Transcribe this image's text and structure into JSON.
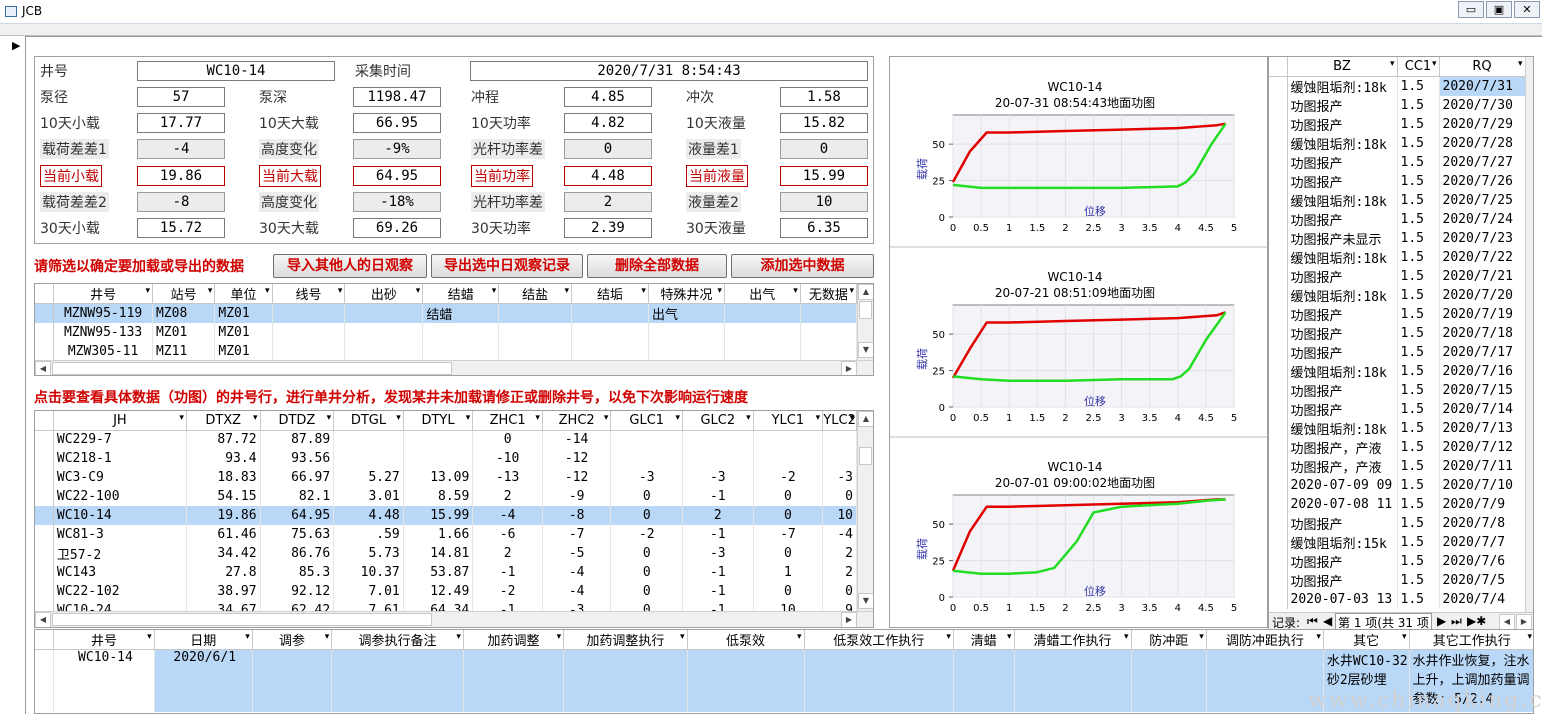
{
  "window": {
    "title": "JCB",
    "minimize": "▭",
    "restore": "▣",
    "close": "✕"
  },
  "info": {
    "r1": {
      "jh_label": "井号",
      "jh_val": "WC10-14",
      "cjsj_label": "采集时间",
      "cjsj_val": "2020/7/31  8:54:43"
    },
    "rows": [
      [
        {
          "l": "泵径",
          "v": "57",
          "t": "n"
        },
        {
          "l": "泵深",
          "v": "1198.47",
          "t": "n"
        },
        {
          "l": "冲程",
          "v": "4.85",
          "t": "n"
        },
        {
          "l": "冲次",
          "v": "1.58",
          "t": "n"
        }
      ],
      [
        {
          "l": "10天小载",
          "v": "17.77",
          "t": "n"
        },
        {
          "l": "10天大载",
          "v": "66.95",
          "t": "n"
        },
        {
          "l": "10天功率",
          "v": "4.82",
          "t": "n"
        },
        {
          "l": "10天液量",
          "v": "15.82",
          "t": "n"
        }
      ],
      [
        {
          "l": "载荷差差1",
          "v": "-4",
          "t": "g"
        },
        {
          "l": "高度变化",
          "v": "-9%",
          "t": "g"
        },
        {
          "l": "光杆功率差",
          "v": "0",
          "t": "g"
        },
        {
          "l": "液量差1",
          "v": "0",
          "t": "g"
        }
      ],
      [
        {
          "l": "当前小载",
          "v": "19.86",
          "t": "r"
        },
        {
          "l": "当前大载",
          "v": "64.95",
          "t": "r"
        },
        {
          "l": "当前功率",
          "v": "4.48",
          "t": "r"
        },
        {
          "l": "当前液量",
          "v": "15.99",
          "t": "r"
        }
      ],
      [
        {
          "l": "载荷差差2",
          "v": "-8",
          "t": "g"
        },
        {
          "l": "高度变化",
          "v": "-18%",
          "t": "g"
        },
        {
          "l": "光杆功率差",
          "v": "2",
          "t": "g"
        },
        {
          "l": "液量差2",
          "v": "10",
          "t": "g"
        }
      ],
      [
        {
          "l": "30天小载",
          "v": "15.72",
          "t": "n"
        },
        {
          "l": "30天大载",
          "v": "69.26",
          "t": "n"
        },
        {
          "l": "30天功率",
          "v": "2.39",
          "t": "n"
        },
        {
          "l": "30天液量",
          "v": "6.35",
          "t": "n"
        }
      ]
    ]
  },
  "filter_note": "请筛选以确定要加载或导出的数据",
  "buttons": {
    "import": "导入其他人的日观察",
    "export": "导出选中日观察记录",
    "delete_all": "删除全部数据",
    "add_selected": "添加选中数据"
  },
  "grid1": {
    "headers": [
      "井号",
      "站号",
      "单位",
      "线号",
      "出砂",
      "结蜡",
      "结盐",
      "结垢",
      "特殊井况",
      "出气",
      "无数据"
    ],
    "rows": [
      [
        "MZNW95-119",
        "MZ08",
        "MZ01",
        "",
        "",
        "结蜡",
        "",
        "",
        "出气",
        "",
        ""
      ],
      [
        "MZNW95-133",
        "MZ01",
        "MZ01",
        "",
        "",
        "",
        "",
        "",
        "",
        "",
        ""
      ],
      [
        "MZW305-11",
        "MZ11",
        "MZ01",
        "",
        "",
        "",
        "",
        "",
        "",
        "",
        ""
      ]
    ]
  },
  "click_note": "点击要查看具体数据（功图）的井号行，进行单井分析，发现某井未加载请修正或删除井号，以免下次影响运行速度",
  "grid2": {
    "headers": [
      "JH",
      "DTXZ",
      "DTDZ",
      "DTGL",
      "DTYL",
      "ZHC1",
      "ZHC2",
      "GLC1",
      "GLC2",
      "YLC1",
      "YLC2"
    ],
    "rows": [
      [
        "WC229-7",
        "87.72",
        "87.89",
        "",
        "",
        "0",
        "-14",
        "",
        "",
        "",
        ""
      ],
      [
        "WC218-1",
        "93.4",
        "93.56",
        "",
        "",
        "-10",
        "-12",
        "",
        "",
        "",
        ""
      ],
      [
        "WC3-C9",
        "18.83",
        "66.97",
        "5.27",
        "13.09",
        "-13",
        "-12",
        "-3",
        "-3",
        "-2",
        "-3"
      ],
      [
        "WC22-100",
        "54.15",
        "82.1",
        "3.01",
        "8.59",
        "2",
        "-9",
        "0",
        "-1",
        "0",
        "0"
      ],
      [
        "WC10-14",
        "19.86",
        "64.95",
        "4.48",
        "15.99",
        "-4",
        "-8",
        "0",
        "2",
        "0",
        "10"
      ],
      [
        "WC81-3",
        "61.46",
        "75.63",
        ".59",
        "1.66",
        "-6",
        "-7",
        "-2",
        "-1",
        "-7",
        "-4"
      ],
      [
        "卫57-2",
        "34.42",
        "86.76",
        "5.73",
        "14.81",
        "2",
        "-5",
        "0",
        "-3",
        "0",
        "2"
      ],
      [
        "WC143",
        "27.8",
        "85.3",
        "10.37",
        "53.87",
        "-1",
        "-4",
        "0",
        "-1",
        "1",
        "2"
      ],
      [
        "WC22-102",
        "38.97",
        "92.12",
        "7.01",
        "12.49",
        "-2",
        "-4",
        "0",
        "-1",
        "0",
        "0"
      ],
      [
        "WC10-24",
        "34.67",
        "62.42",
        "7.61",
        "64.34",
        "-1",
        "-3",
        "0",
        "-1",
        "10",
        "9"
      ]
    ]
  },
  "charts": [
    {
      "title": "WC10-14",
      "subtitle": "20-07-31  08:54:43地面功图",
      "ylabel": "载荷",
      "xlabel": "位移"
    },
    {
      "title": "WC10-14",
      "subtitle": "20-07-21  08:51:09地面功图",
      "ylabel": "载荷",
      "xlabel": "位移"
    },
    {
      "title": "WC10-14",
      "subtitle": "20-07-01  09:00:02地面功图",
      "ylabel": "载荷",
      "xlabel": "位移"
    }
  ],
  "chart_data": [
    {
      "type": "line",
      "title": "WC10-14",
      "subtitle": "20-07-31  08:54:43地面功图",
      "xlabel": "位移",
      "ylabel": "载荷",
      "xlim": [
        0,
        5
      ],
      "ylim": [
        0,
        70
      ],
      "xticks": [
        "0",
        "0.5",
        "1",
        "1.5",
        "2",
        "2.5",
        "3",
        "3.5",
        "4",
        "4.5",
        "5"
      ],
      "yticks": [
        "0",
        "25",
        "50"
      ],
      "series": [
        {
          "color": "#e00000",
          "x": [
            0,
            0.3,
            0.6,
            1,
            2,
            3,
            4,
            4.7,
            4.85
          ],
          "y": [
            24,
            45,
            58,
            58,
            59,
            60,
            61,
            63,
            64
          ]
        },
        {
          "color": "#22dd22",
          "x": [
            4.85,
            4.6,
            4.3,
            4.15,
            4,
            3,
            2,
            1,
            0.5,
            0
          ],
          "y": [
            64,
            50,
            30,
            24,
            21,
            20,
            20,
            20,
            20,
            22
          ]
        }
      ]
    },
    {
      "title": "WC10-14",
      "subtitle": "20-07-21  08:51:09地面功图",
      "type": "line",
      "xlabel": "位移",
      "ylabel": "载荷",
      "xlim": [
        0,
        5
      ],
      "ylim": [
        0,
        70
      ],
      "xticks": [
        "0",
        "0.5",
        "1",
        "1.5",
        "2",
        "2.5",
        "3",
        "3.5",
        "4",
        "4.5",
        "5"
      ],
      "yticks": [
        "0",
        "25",
        "50"
      ],
      "series": [
        {
          "color": "#e00000",
          "x": [
            0,
            0.3,
            0.6,
            1,
            2,
            3,
            4,
            4.7,
            4.85
          ],
          "y": [
            20,
            40,
            58,
            58,
            59,
            60,
            61,
            63,
            65
          ]
        },
        {
          "color": "#22dd22",
          "x": [
            4.85,
            4.5,
            4.2,
            4.05,
            3.9,
            3,
            2,
            1,
            0.5,
            0
          ],
          "y": [
            65,
            46,
            26,
            21,
            19,
            19,
            18,
            18,
            19,
            21
          ]
        }
      ]
    },
    {
      "title": "WC10-14",
      "subtitle": "20-07-01  09:00:02地面功图",
      "type": "line",
      "xlabel": "位移",
      "ylabel": "载荷",
      "xlim": [
        0,
        5
      ],
      "ylim": [
        0,
        70
      ],
      "xticks": [
        "0",
        "0.5",
        "1",
        "1.5",
        "2",
        "2.5",
        "3",
        "3.5",
        "4",
        "4.5",
        "5"
      ],
      "yticks": [
        "0",
        "25",
        "50"
      ],
      "series": [
        {
          "color": "#e00000",
          "x": [
            0,
            0.3,
            0.6,
            1,
            2,
            3,
            4,
            4.7,
            4.85
          ],
          "y": [
            18,
            45,
            62,
            62,
            63,
            64,
            65,
            67,
            67
          ]
        },
        {
          "color": "#22dd22",
          "x": [
            4.85,
            4.5,
            4,
            3,
            2.5,
            2.2,
            1.8,
            1.5,
            1,
            0.5,
            0
          ],
          "y": [
            67,
            66,
            64,
            62,
            58,
            38,
            20,
            17,
            16,
            16,
            18
          ]
        }
      ]
    }
  ],
  "right_grid": {
    "headers": [
      "BZ",
      "CC1",
      "RQ"
    ],
    "rows": [
      [
        "缓蚀阻垢剂:18k",
        "1.5",
        "2020/7/31"
      ],
      [
        "功图报产",
        "1.5",
        "2020/7/30"
      ],
      [
        "功图报产",
        "1.5",
        "2020/7/29"
      ],
      [
        "缓蚀阻垢剂:18k",
        "1.5",
        "2020/7/28"
      ],
      [
        "功图报产",
        "1.5",
        "2020/7/27"
      ],
      [
        "功图报产",
        "1.5",
        "2020/7/26"
      ],
      [
        "缓蚀阻垢剂:18k",
        "1.5",
        "2020/7/25"
      ],
      [
        "功图报产",
        "1.5",
        "2020/7/24"
      ],
      [
        "功图报产未显示",
        "1.5",
        "2020/7/23"
      ],
      [
        "缓蚀阻垢剂:18k",
        "1.5",
        "2020/7/22"
      ],
      [
        "功图报产",
        "1.5",
        "2020/7/21"
      ],
      [
        "缓蚀阻垢剂:18k",
        "1.5",
        "2020/7/20"
      ],
      [
        "功图报产",
        "1.5",
        "2020/7/19"
      ],
      [
        "功图报产",
        "1.5",
        "2020/7/18"
      ],
      [
        "功图报产",
        "1.5",
        "2020/7/17"
      ],
      [
        "缓蚀阻垢剂:18k",
        "1.5",
        "2020/7/16"
      ],
      [
        "功图报产",
        "1.5",
        "2020/7/15"
      ],
      [
        "功图报产",
        "1.5",
        "2020/7/14"
      ],
      [
        "缓蚀阻垢剂:18k",
        "1.5",
        "2020/7/13"
      ],
      [
        "功图报产，产液",
        "1.5",
        "2020/7/12"
      ],
      [
        "功图报产，产液",
        "1.5",
        "2020/7/11"
      ],
      [
        "2020-07-09 09",
        "1.5",
        "2020/7/10"
      ],
      [
        "2020-07-08 11",
        "1.5",
        "2020/7/9"
      ],
      [
        "功图报产",
        "1.5",
        "2020/7/8"
      ],
      [
        "缓蚀阻垢剂:15k",
        "1.5",
        "2020/7/7"
      ],
      [
        "功图报产",
        "1.5",
        "2020/7/6"
      ],
      [
        "功图报产",
        "1.5",
        "2020/7/5"
      ],
      [
        "2020-07-03 13",
        "1.5",
        "2020/7/4"
      ]
    ],
    "nav": {
      "label": "记录:",
      "first": "⏮",
      "prev": "◀",
      "pos": "第 1 项(共 31 项",
      "next": "▶",
      "last": "⏭",
      "new": "▶✱"
    }
  },
  "bottom_grid": {
    "headers": [
      "井号",
      "日期",
      "调参",
      "调参执行备注",
      "加药调整",
      "加药调整执行",
      "低泵效",
      "低泵效工作执行",
      "清蜡",
      "清蜡工作执行",
      "防冲距",
      "调防冲距执行",
      "其它",
      "其它工作执行"
    ],
    "row": [
      "WC10-14",
      "2020/6/1",
      "",
      "",
      "",
      "",
      "",
      "",
      "",
      "",
      "",
      "",
      "水井WC10-32砂2层砂埋",
      "水井作业恢复，注水上升，上调加药量调参数:.5/2.4"
    ]
  },
  "watermark": "www.chinaqking.com"
}
